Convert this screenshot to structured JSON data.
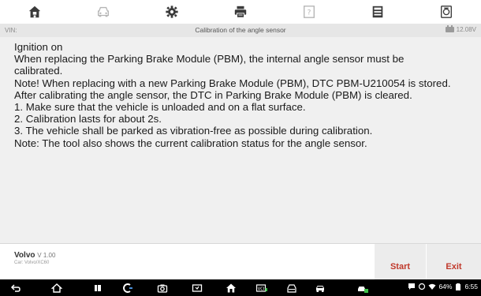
{
  "toolbar": {
    "items": [
      {
        "name": "home",
        "icon": "home-icon"
      },
      {
        "name": "vehicle",
        "icon": "car-icon"
      },
      {
        "name": "settings",
        "icon": "gear-icon"
      },
      {
        "name": "print",
        "icon": "printer-icon"
      },
      {
        "name": "help",
        "icon": "help-icon"
      },
      {
        "name": "save",
        "icon": "save-icon"
      },
      {
        "name": "data-logging",
        "icon": "data-logging-icon"
      }
    ]
  },
  "infobar": {
    "vin_label": "VIN:",
    "title": "Calibration of the angle sensor",
    "voltage": "12.08V"
  },
  "instructions": [
    "Ignition on",
    "When replacing the Parking Brake Module (PBM), the internal angle sensor must be",
    "calibrated.",
    "Note! When replacing with a new Parking Brake Module (PBM), DTC PBM-U210054 is stored.",
    "After calibrating the angle sensor, the DTC in Parking Brake Module (PBM) is cleared.",
    "1. Make sure that the vehicle is unloaded and on a flat surface.",
    "2. Calibration lasts for about 2s.",
    "3. The vehicle shall be parked as vibration-free as possible during calibration.",
    "Note: The tool also shows the current calibration status for the angle sensor."
  ],
  "footer": {
    "vehicle_name": "Volvo",
    "vehicle_version": "V 1.00",
    "vehicle_car": "Car: Volvo/XC60",
    "start_label": "Start",
    "exit_label": "Exit"
  },
  "statusbar": {
    "battery": "64%",
    "time": "6:55"
  },
  "colors": {
    "accent": "#c0392b",
    "content_bg": "#f0f0f0",
    "infobar_bg": "#e6e6e6",
    "navbar_bg": "#000000"
  }
}
